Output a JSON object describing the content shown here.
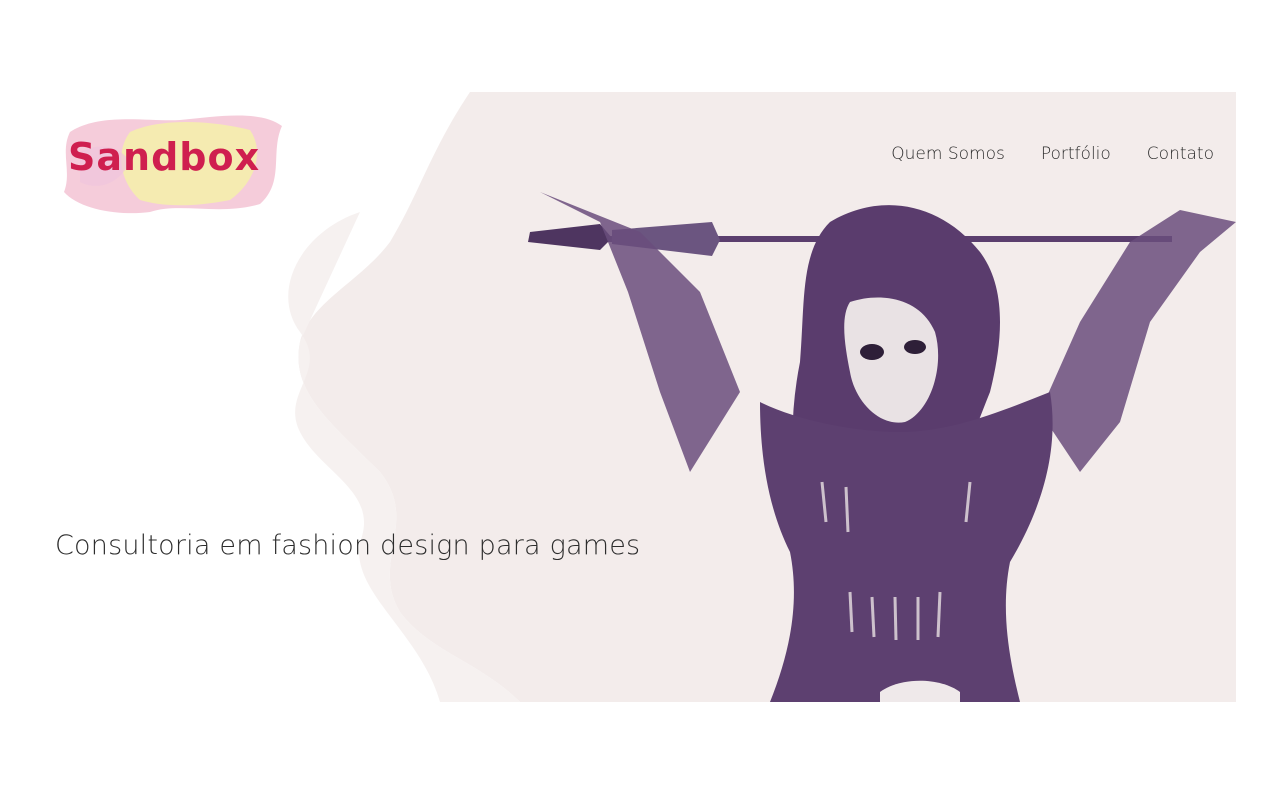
{
  "brand": {
    "logo_text": "Sandbox",
    "logo_color": "#cf1f4f",
    "splash_colors": [
      "#f4b6c8",
      "#f6f2a0",
      "#f1d7e6"
    ]
  },
  "nav": {
    "items": [
      {
        "label": "Quem Somos"
      },
      {
        "label": "Portfólio"
      },
      {
        "label": "Contato"
      }
    ]
  },
  "hero": {
    "tagline": "Consultoria em fashion design para games",
    "background_color": "#f3eeec",
    "illustration_color": "#5b3f6e",
    "illustration": "woman-holding-staff-illustration"
  }
}
